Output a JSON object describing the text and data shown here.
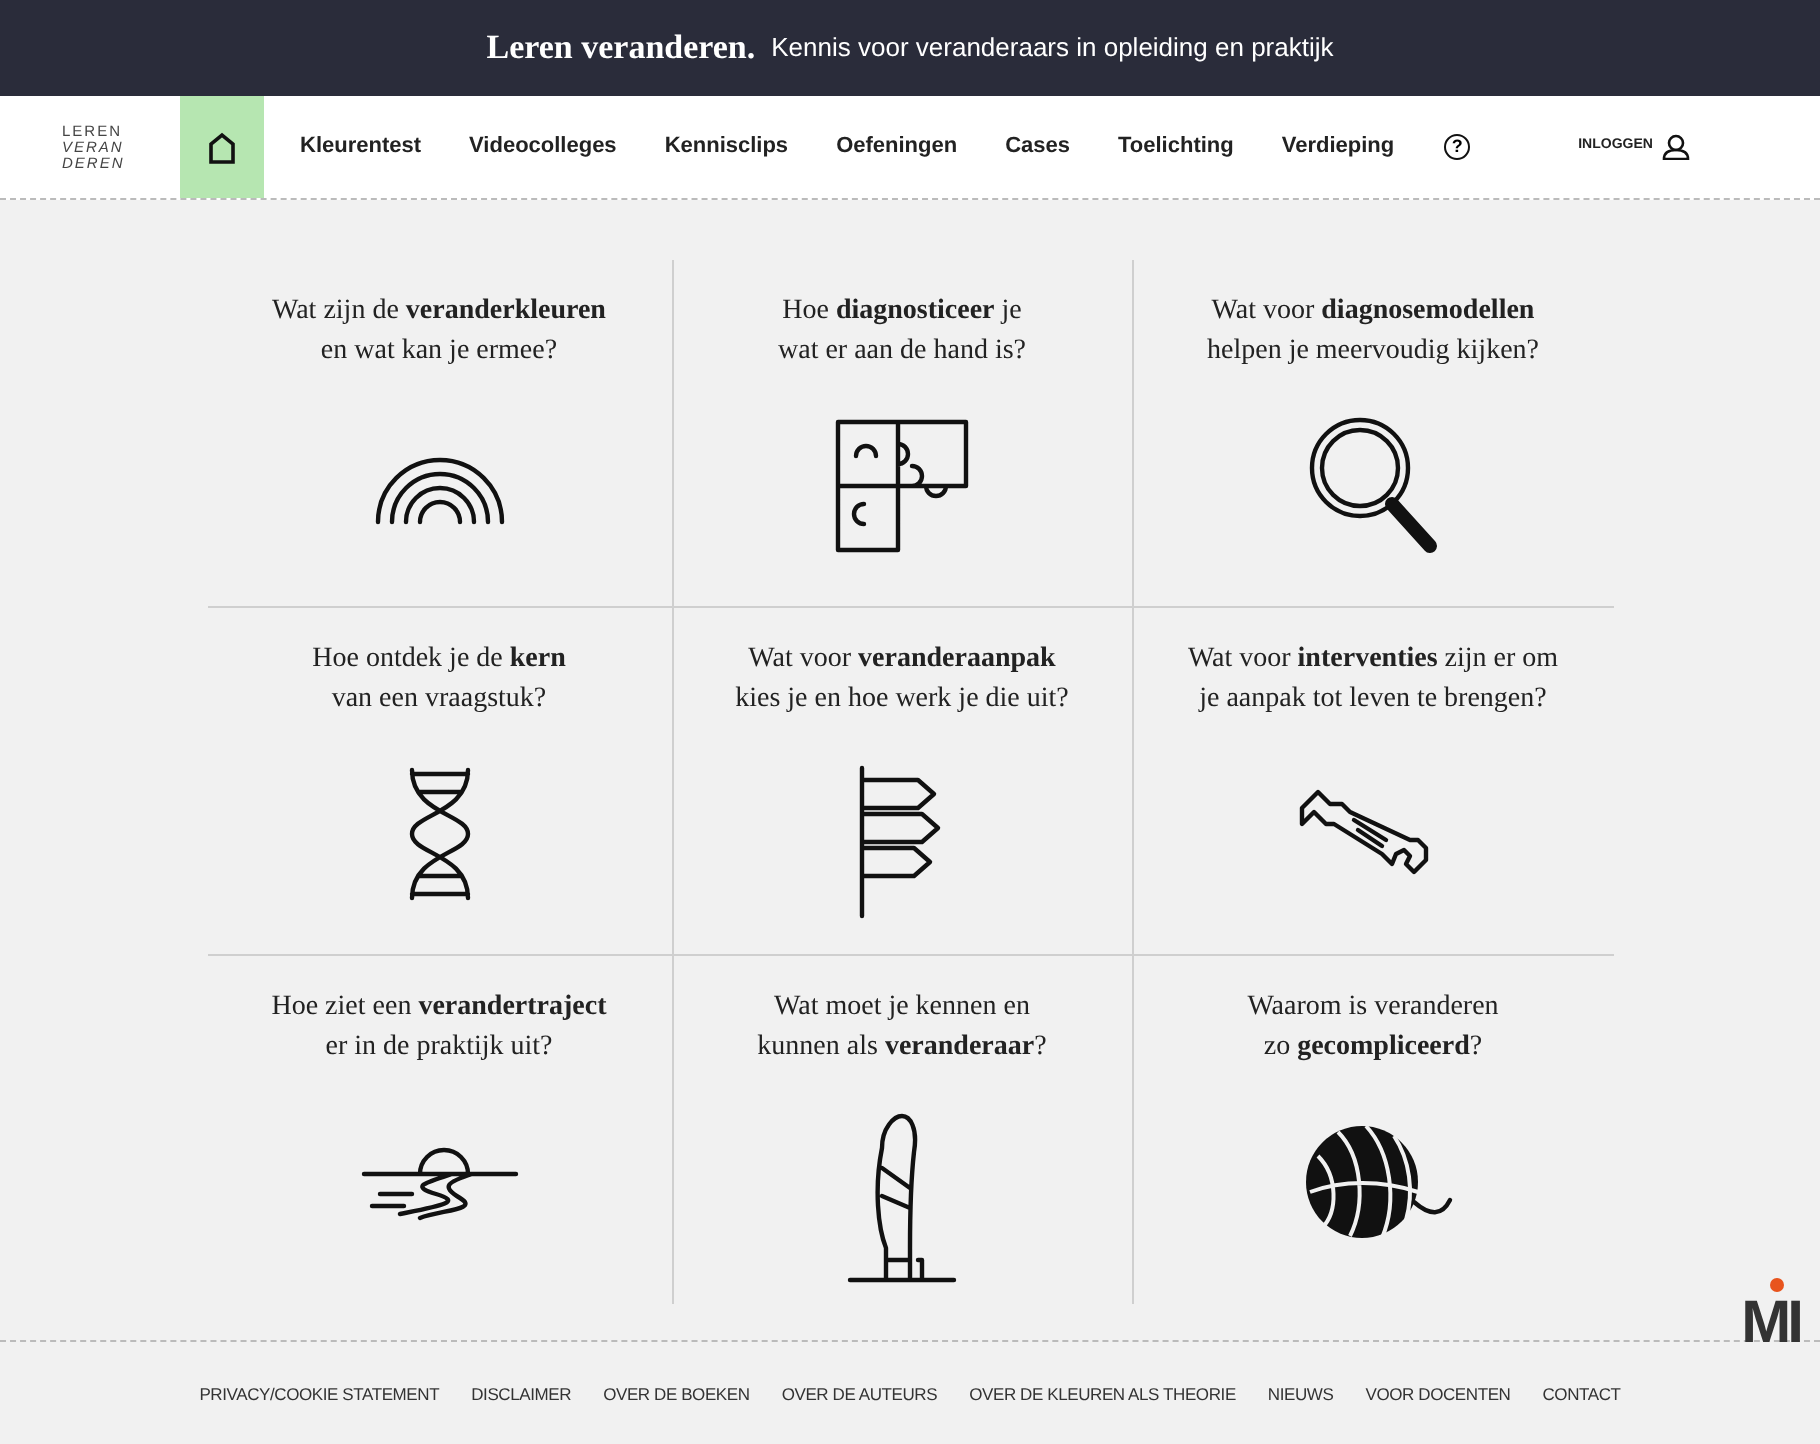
{
  "banner": {
    "title": "Leren veranderen.",
    "subtitle": "Kennis voor veranderaars in opleiding en praktijk"
  },
  "logo": [
    "LEREN",
    "VERAN",
    "DEREN"
  ],
  "nav": {
    "home": {
      "selected": true
    },
    "items": [
      {
        "label": "Kleurentest",
        "selected": false
      },
      {
        "label": "Videocolleges",
        "selected": false
      },
      {
        "label": "Kennisclips",
        "selected": false
      },
      {
        "label": "Oefeningen",
        "selected": false
      },
      {
        "label": "Cases",
        "selected": false
      },
      {
        "label": "Toelichting",
        "selected": false
      },
      {
        "label": "Verdieping",
        "selected": false
      }
    ],
    "help": "?",
    "login": "INLOGGEN"
  },
  "cards": [
    {
      "title": "Wat zijn de **veranderkleuren**\nen wat kan je ermee?"
    },
    {
      "title": "Hoe **diagnosticeer** je\nwat er aan de hand is?"
    },
    {
      "title": "Wat voor **diagnosemodellen**\nhelpen je meervoudig kijken?"
    },
    {
      "title": "Hoe ontdek je de **kern**\nvan een vraagstuk?"
    },
    {
      "title": "Wat voor **veranderaanpak**\nkies je en hoe werk je die uit?"
    },
    {
      "title": "Wat voor **interventies** zijn er om\nje aanpak tot leven te brengen?"
    },
    {
      "title": "Hoe ziet een **verandertraject**\ner in de praktijk uit?"
    },
    {
      "title": "Wat moet je kennen en\nkunnen als **veranderaar**?"
    },
    {
      "title": "Waarom is veranderen\nzo **gecompliceerd**?"
    }
  ],
  "footer": [
    "PRIVACY/COOKIE STATEMENT",
    "DISCLAIMER",
    "OVER DE BOEKEN",
    "OVER DE AUTEURS",
    "OVER DE KLEUREN ALS THEORIE",
    "NIEUWS",
    "VOOR DOCENTEN",
    "CONTACT"
  ],
  "badge": "MI"
}
